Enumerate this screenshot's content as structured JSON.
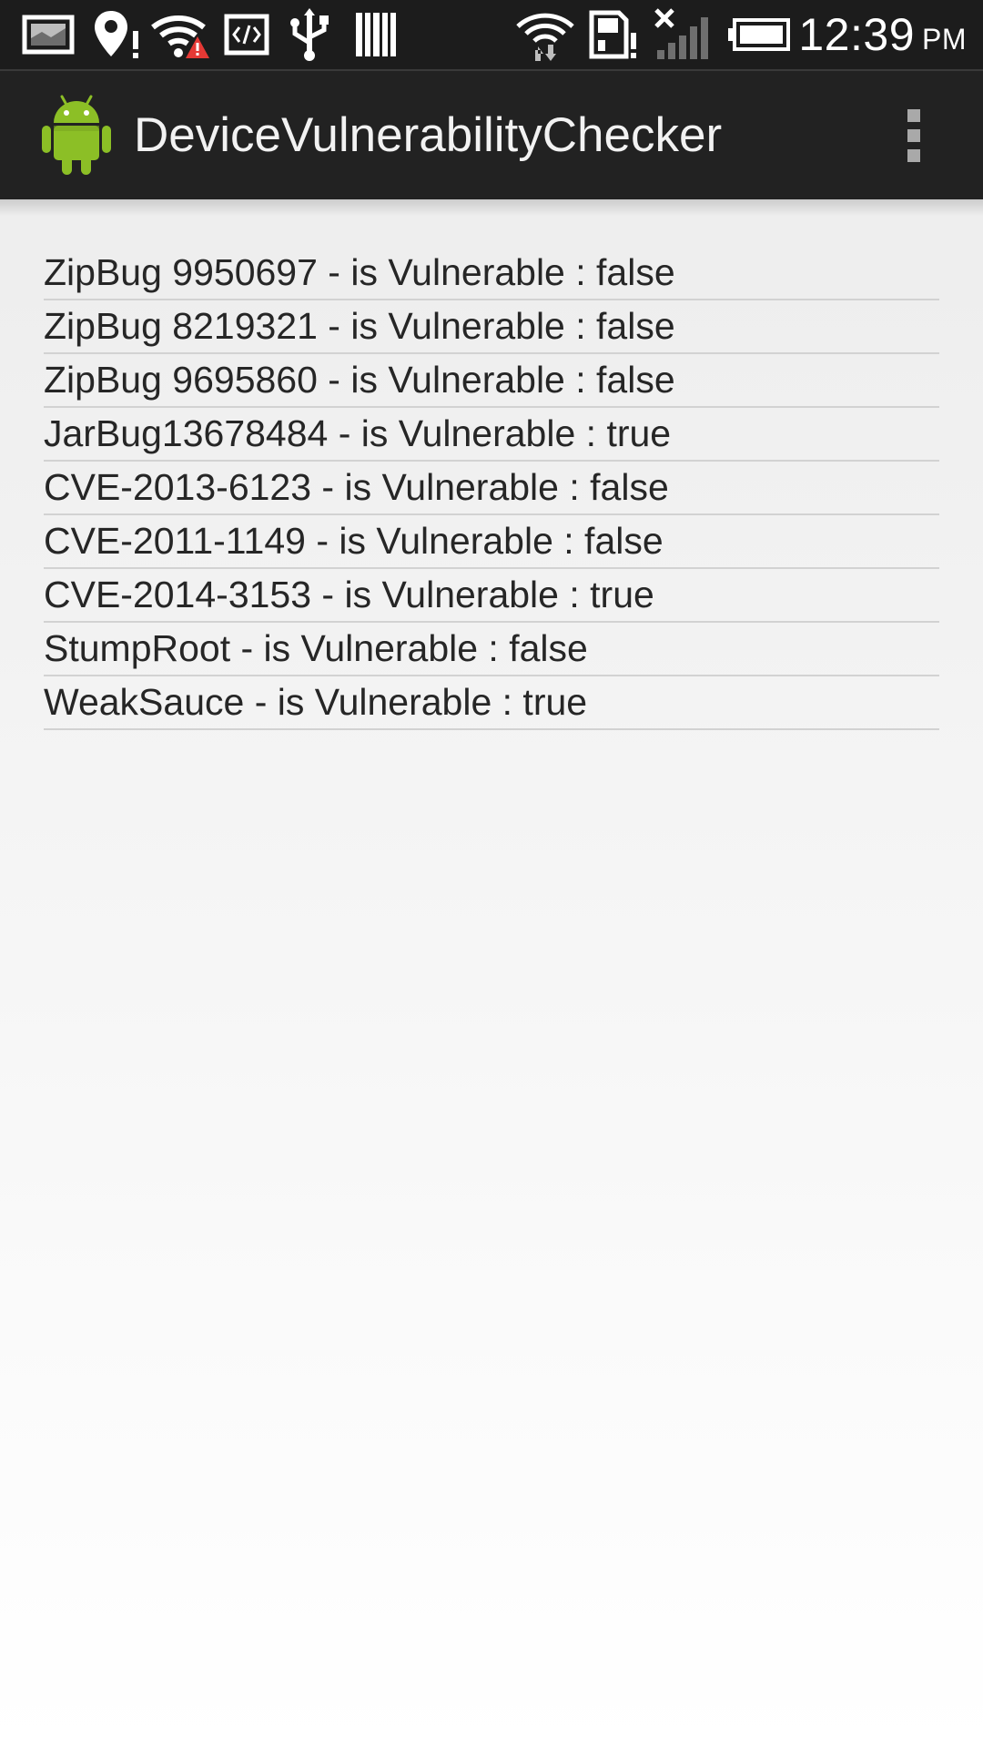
{
  "status_bar": {
    "icons": [
      "image-notification-icon",
      "location-alert-icon",
      "wifi-warning-icon",
      "code-icon",
      "usb-icon",
      "barcode-icon",
      "wifi-data-icon",
      "sd-card-alert-icon",
      "no-signal-icon",
      "battery-icon"
    ],
    "time": "12:39",
    "ampm": "PM"
  },
  "action_bar": {
    "title": "DeviceVulnerabilityChecker",
    "app_icon": "android-robot-icon",
    "overflow_icon": "overflow-menu-icon"
  },
  "results": [
    "ZipBug 9950697 - is Vulnerable :  false",
    "ZipBug 8219321 - is Vulnerable :  false",
    "ZipBug 9695860 - is Vulnerable :  false",
    "JarBug13678484 - is Vulnerable :  true",
    "CVE-2013-6123 - is Vulnerable :  false",
    "CVE-2011-1149 - is Vulnerable :  false",
    "CVE-2014-3153 - is Vulnerable :  true",
    "StumpRoot - is Vulnerable :  false",
    "WeakSauce - is Vulnerable :  true"
  ],
  "colors": {
    "status_bar_bg": "#1c1c1c",
    "action_bar_bg": "#222222",
    "android_green": "#8cbf26",
    "text": "#262626",
    "warning_red": "#e53935"
  }
}
